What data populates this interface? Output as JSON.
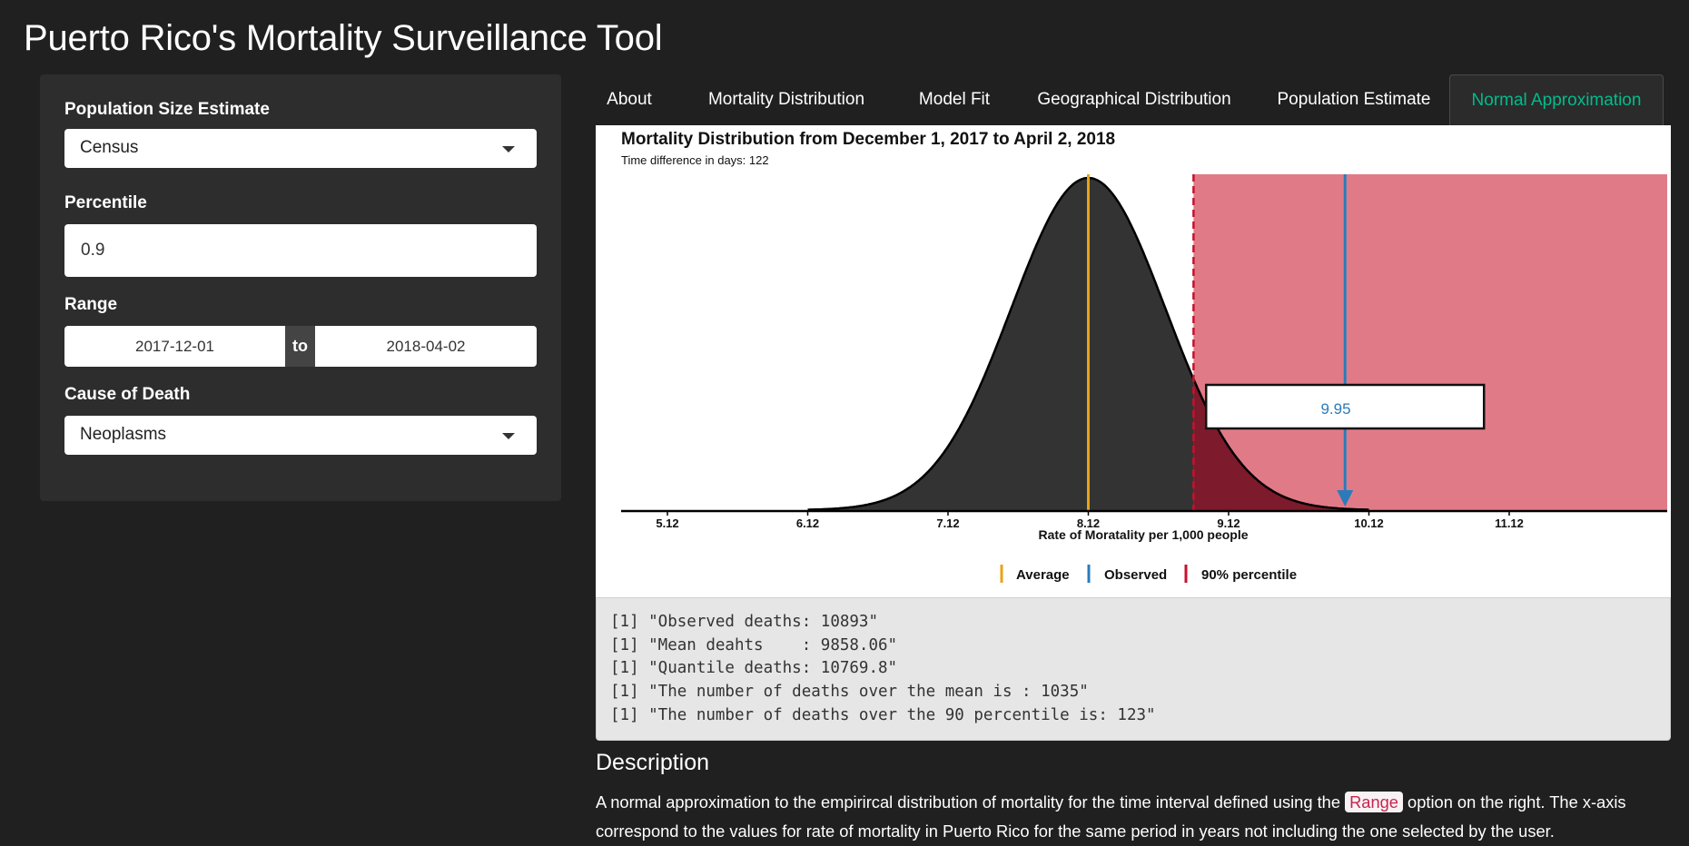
{
  "app": {
    "title": "Puerto Rico's Mortality Surveillance Tool"
  },
  "sidebar": {
    "population": {
      "label": "Population Size Estimate",
      "value": "Census"
    },
    "percentile": {
      "label": "Percentile",
      "value": "0.9"
    },
    "range": {
      "label": "Range",
      "start": "2017-12-01",
      "separator": "to",
      "end": "2018-04-02"
    },
    "cause": {
      "label": "Cause of Death",
      "value": "Neoplasms"
    }
  },
  "tabs": [
    {
      "label": "About"
    },
    {
      "label": "Mortality Distribution"
    },
    {
      "label": "Model Fit"
    },
    {
      "label": "Geographical Distribution"
    },
    {
      "label": "Population Estimate"
    },
    {
      "label": "Normal Approximation",
      "active": true
    }
  ],
  "plot": {
    "title": "Mortality Distribution from December 1, 2017 to April 2, 2018",
    "subtitle": "Time difference in days: 122",
    "xlabel": "Rate of Moratality per 1,000 people",
    "tick_labels": [
      "5.12",
      "6.12",
      "7.12",
      "8.12",
      "9.12",
      "10.12",
      "11.12"
    ],
    "observed_label": "9.95",
    "legend": {
      "average": "Average",
      "observed": "Observed",
      "percentile": "90% percentile"
    }
  },
  "chart_data": {
    "type": "area",
    "title": "Mortality Distribution from December 1, 2017 to April 2, 2018",
    "subtitle": "Time difference in days: 122",
    "xlabel": "Rate of Moratality per 1,000 people",
    "ylabel": "",
    "x_ticks": [
      5.12,
      6.12,
      7.12,
      8.12,
      9.12,
      10.12,
      11.12
    ],
    "xlim": [
      4.8,
      12.2
    ],
    "distribution": {
      "kind": "normal",
      "mean": 8.12,
      "sd": 0.55,
      "x_range": [
        6.12,
        10.12
      ]
    },
    "average": 8.12,
    "percentile_90": 8.87,
    "observed": 9.95,
    "observed_label": "9.95",
    "legend": [
      "Average",
      "Observed",
      "90% percentile"
    ],
    "legend_position": "bottom",
    "colors": {
      "average": "#e8a317",
      "observed": "#2b7bba",
      "percentile": "#c8102e",
      "region": "#e17a87",
      "curve": "#333333",
      "tail": "#7d1a2b"
    }
  },
  "console": {
    "lines": [
      "[1] \"Observed deaths: 10893\"",
      "[1] \"Mean deahts    : 9858.06\"",
      "[1] \"Quantile deaths: 10769.8\"",
      "[1] \"The number of deaths over the mean is : 1035\"",
      "[1] \"The number of deaths over the 90 percentile is: 123\""
    ]
  },
  "description": {
    "heading": "Description",
    "before": "A normal approximation to the empirircal distribution of mortality for the time interval defined using the ",
    "code": "Range",
    "after": " option on the right. The x-axis correspond to the values for rate of mortality in Puerto Rico for the same period in years not including the one selected by the user."
  },
  "colors": {
    "accent": "#00bc8c",
    "background": "#202020",
    "panel": "#2d2d2d"
  }
}
